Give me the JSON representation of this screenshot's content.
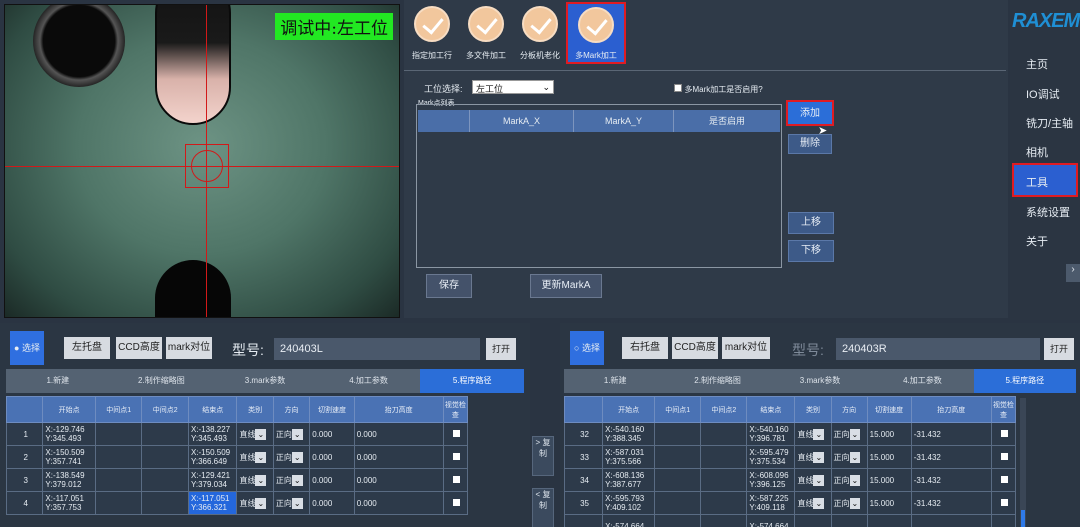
{
  "camera": {
    "status_text": "调试中:左工位"
  },
  "tools": [
    {
      "label": "指定加工行",
      "selected": false
    },
    {
      "label": "多文件加工",
      "selected": false
    },
    {
      "label": "分板机老化",
      "selected": false
    },
    {
      "label": "多Mark加工",
      "selected": true
    }
  ],
  "mark_panel": {
    "station_label": "工位选择:",
    "station_value": "左工位",
    "enable_label": "多Mark加工是否启用?",
    "list_title": "Mark点列表",
    "columns": [
      "",
      "MarkA_X",
      "MarkA_Y",
      "是否启用"
    ],
    "add_button": "添加",
    "delete_button": "删除",
    "up_button": "上移",
    "down_button": "下移",
    "save_button": "保存",
    "update_button": "更新MarkA"
  },
  "logo": "RAXEM",
  "menu": [
    "主页",
    "IO调试",
    "铣刀/主轴",
    "相机",
    "工具",
    "系统设置",
    "关于"
  ],
  "menu_active": "工具",
  "left": {
    "radio_label": "选择",
    "tray_button": "左托盘",
    "ccd_button": "CCD高度",
    "mark_button": "mark对位",
    "model_label": "型号:",
    "model_value": "240403L",
    "open_button": "打开",
    "tabs": [
      "1.新建",
      "2.制作缩略图",
      "3.mark参数",
      "4.加工参数",
      "5.程序路径"
    ],
    "active_tab": 4,
    "columns": [
      "",
      "开始点",
      "中间点1",
      "中间点2",
      "结束点",
      "类别",
      "方向",
      "切割速度",
      "抬刀高度",
      "视觉检查"
    ],
    "rows": [
      {
        "idx": "1",
        "start": "X:-129.746 Y:345.493",
        "end": "X:-138.227 Y:345.493",
        "type": "直线",
        "dir": "正向",
        "speed": "0.000",
        "lift": "0.000"
      },
      {
        "idx": "2",
        "start": "X:-150.509 Y:357.741",
        "end": "X:-150.509 Y:366.649",
        "type": "直线",
        "dir": "正向",
        "speed": "0.000",
        "lift": "0.000"
      },
      {
        "idx": "3",
        "start": "X:-138.549 Y:379.012",
        "end": "X:-129.421 Y:379.034",
        "type": "直线",
        "dir": "正向",
        "speed": "0.000",
        "lift": "0.000"
      },
      {
        "idx": "4",
        "start": "X:-117.051 Y:357.753",
        "end": "X:-117.051 Y:366.321",
        "type": "直线",
        "dir": "正向",
        "speed": "0.000",
        "lift": "0.000"
      }
    ]
  },
  "copy_right": "> 复制",
  "copy_left": "< 复制",
  "right": {
    "radio_label": "选择",
    "tray_button": "右托盘",
    "ccd_button": "CCD高度",
    "mark_button": "mark对位",
    "model_label": "型号:",
    "model_value": "240403R",
    "open_button": "打开",
    "tabs": [
      "1.新建",
      "2.制作缩略图",
      "3.mark参数",
      "4.加工参数",
      "5.程序路径"
    ],
    "active_tab": 4,
    "columns": [
      "",
      "开始点",
      "中间点1",
      "中间点2",
      "结束点",
      "类别",
      "方向",
      "切割速度",
      "抬刀高度",
      "视觉检查"
    ],
    "rows": [
      {
        "idx": "32",
        "start": "X:-540.160 Y:388.345",
        "end": "X:-540.160 Y:396.781",
        "type": "直线",
        "dir": "正向",
        "speed": "15.000",
        "lift": "-31.432"
      },
      {
        "idx": "33",
        "start": "X:-587.031 Y:375.566",
        "end": "X:-595.479 Y:375.534",
        "type": "直线",
        "dir": "正向",
        "speed": "15.000",
        "lift": "-31.432"
      },
      {
        "idx": "34",
        "start": "X:-608.136 Y:387.677",
        "end": "X:-608.096 Y:396.125",
        "type": "直线",
        "dir": "正向",
        "speed": "15.000",
        "lift": "-31.432"
      },
      {
        "idx": "35",
        "start": "X:-595.793 Y:409.102",
        "end": "X:-587.225 Y:409.118",
        "type": "直线",
        "dir": "正向",
        "speed": "15.000",
        "lift": "-31.432"
      },
      {
        "idx": "",
        "start": "X:-574.664",
        "end": "X:-574.664",
        "type": "",
        "dir": "",
        "speed": "",
        "lift": ""
      }
    ]
  }
}
